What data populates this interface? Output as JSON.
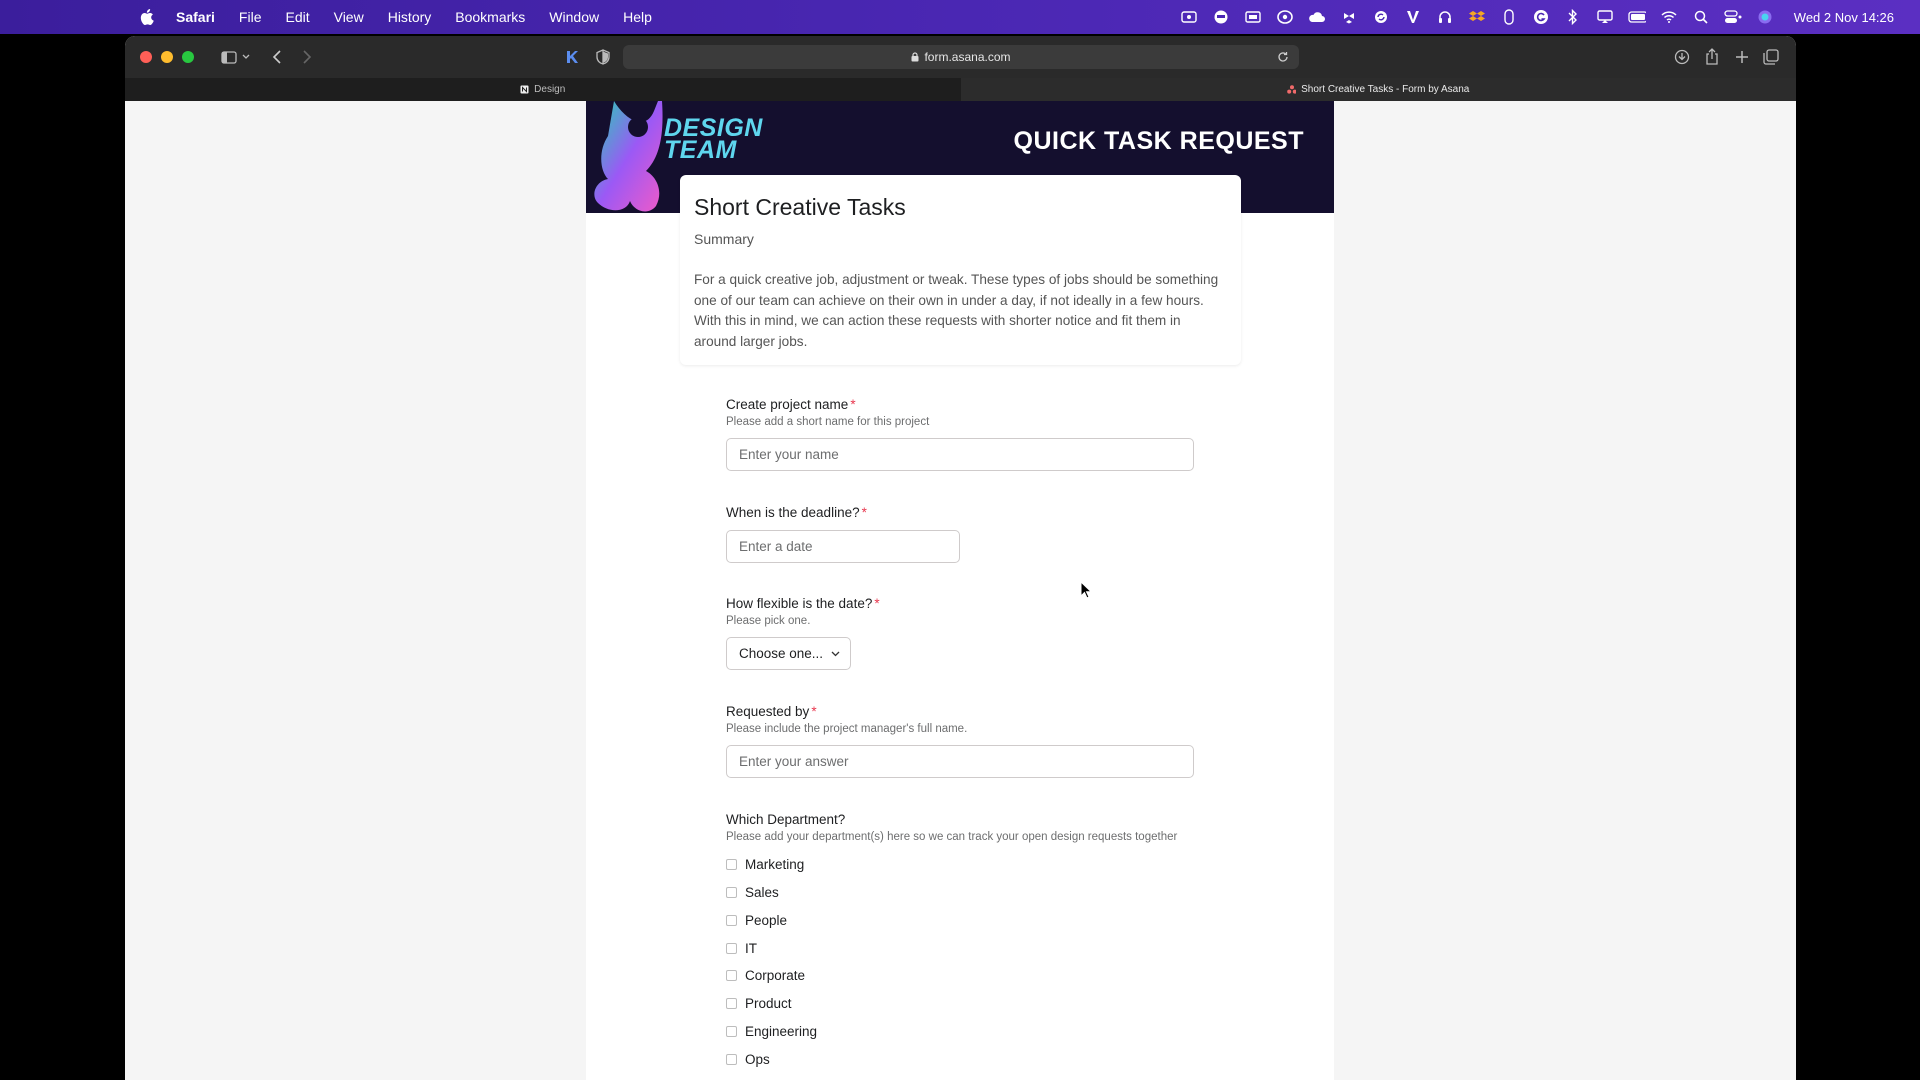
{
  "menubar": {
    "app": "Safari",
    "items": [
      "File",
      "Edit",
      "View",
      "History",
      "Bookmarks",
      "Window",
      "Help"
    ],
    "clock": "Wed 2 Nov  14:26",
    "status_icons": [
      "video-icon",
      "screen-record-icon",
      "display-icon",
      "creative-cloud-icon",
      "cloud-icon",
      "dropbox-like-icon",
      "sync-icon",
      "vectorworks-icon",
      "audio-icon",
      "dropbox-icon",
      "mouse-icon",
      "grammarly-icon",
      "bluetooth-icon",
      "airplay-icon",
      "battery-icon",
      "wifi-icon",
      "search-icon",
      "control-center-icon",
      "siri-icon"
    ]
  },
  "browser": {
    "url": "form.asana.com",
    "tabs": [
      {
        "label": "Design",
        "active": false
      },
      {
        "label": "Short Creative Tasks - Form by Asana",
        "active": true
      }
    ]
  },
  "form": {
    "banner_brand_line1": "DESIGN",
    "banner_brand_line2": "TEAM",
    "banner_title": "QUICK TASK REQUEST",
    "title": "Short Creative Tasks",
    "summary_label": "Summary",
    "description": "For a quick creative job, adjustment or tweak. These types of jobs should be something one of our team can achieve on their own in under a day, if not ideally in a few hours. With this in mind, we can action these requests with shorter notice and fit them in around larger jobs.",
    "required_mark": "*",
    "fields": {
      "project_name": {
        "label": "Create project name",
        "help": "Please add a short name for this project",
        "placeholder": "Enter your name"
      },
      "deadline": {
        "label": "When is the deadline?",
        "placeholder": "Enter a date"
      },
      "flexibility": {
        "label": "How flexible is the date?",
        "help": "Please pick one.",
        "selected": "Choose one..."
      },
      "requested_by": {
        "label": "Requested by",
        "help": "Please include the project manager's full name.",
        "placeholder": "Enter your answer"
      },
      "department": {
        "label": "Which Department?",
        "help": "Please add your department(s) here so we can track your open design requests together",
        "options": [
          "Marketing",
          "Sales",
          "People",
          "IT",
          "Corporate",
          "Product",
          "Engineering",
          "Ops"
        ]
      }
    }
  },
  "colors": {
    "menubar": "#4a27b3",
    "banner": "#140f2e",
    "brand_cyan": "#5fd6ee",
    "required": "#e8384f"
  }
}
